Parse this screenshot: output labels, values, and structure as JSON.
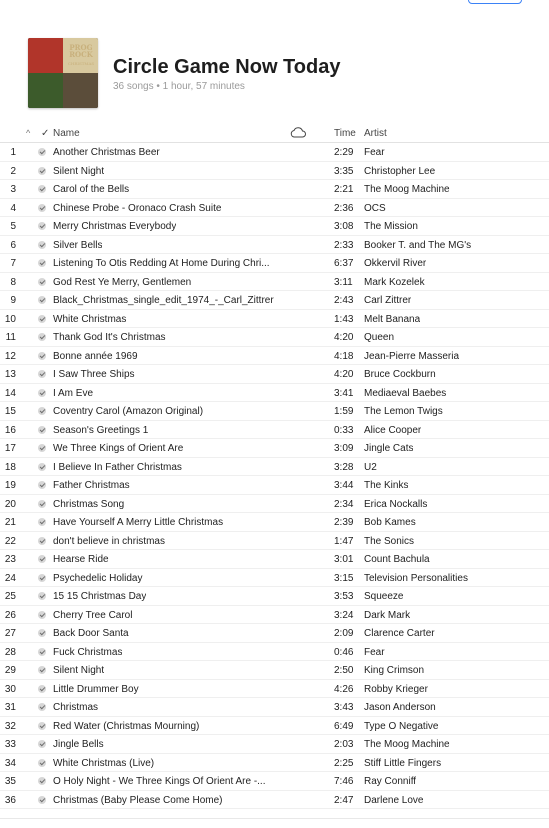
{
  "playlist": {
    "title": "Circle Game Now Today",
    "subtitle": "36 songs • 1 hour, 57 minutes",
    "art_text_main": "PROG ROCK",
    "art_text_sub": "CHRISTMAS"
  },
  "columns": {
    "sort_indicator": "^",
    "check": "✓",
    "name": "Name",
    "time": "Time",
    "artist": "Artist"
  },
  "icons": {
    "cloud": "cloud-icon",
    "check": "checkmark-icon"
  },
  "colors": {
    "accent": "#3b82f6"
  },
  "tracks": [
    {
      "num": "1",
      "name": "Another Christmas Beer",
      "time": "2:29",
      "artist": "Fear"
    },
    {
      "num": "2",
      "name": "Silent Night",
      "time": "3:35",
      "artist": "Christopher Lee"
    },
    {
      "num": "3",
      "name": "Carol of the Bells",
      "time": "2:21",
      "artist": "The Moog Machine"
    },
    {
      "num": "4",
      "name": "Chinese Probe - Oronaco Crash Suite",
      "time": "2:36",
      "artist": "OCS"
    },
    {
      "num": "5",
      "name": "Merry Christmas Everybody",
      "time": "3:08",
      "artist": "The Mission"
    },
    {
      "num": "6",
      "name": "Silver Bells",
      "time": "2:33",
      "artist": "Booker T. and The MG's"
    },
    {
      "num": "7",
      "name": "Listening To Otis Redding At Home During Chri...",
      "time": "6:37",
      "artist": "Okkervil River"
    },
    {
      "num": "8",
      "name": "God Rest Ye Merry, Gentlemen",
      "time": "3:11",
      "artist": "Mark Kozelek"
    },
    {
      "num": "9",
      "name": "Black_Christmas_single_edit_1974_-_Carl_Zittrer",
      "time": "2:43",
      "artist": "Carl Zittrer"
    },
    {
      "num": "10",
      "name": "White Christmas",
      "time": "1:43",
      "artist": "Melt Banana"
    },
    {
      "num": "11",
      "name": "Thank God It's Christmas",
      "time": "4:20",
      "artist": "Queen"
    },
    {
      "num": "12",
      "name": "Bonne année 1969",
      "time": "4:18",
      "artist": "Jean-Pierre Masseria"
    },
    {
      "num": "13",
      "name": "I Saw Three Ships",
      "time": "4:20",
      "artist": "Bruce Cockburn"
    },
    {
      "num": "14",
      "name": "I Am Eve",
      "time": "3:41",
      "artist": "Mediaeval Baebes"
    },
    {
      "num": "15",
      "name": "Coventry Carol  (Amazon Original)",
      "time": "1:59",
      "artist": "The Lemon Twigs"
    },
    {
      "num": "16",
      "name": "Season's Greetings 1",
      "time": "0:33",
      "artist": "Alice Cooper"
    },
    {
      "num": "17",
      "name": "We Three Kings of Orient Are",
      "time": "3:09",
      "artist": "Jingle Cats"
    },
    {
      "num": "18",
      "name": "I Believe In Father Christmas",
      "time": "3:28",
      "artist": "U2"
    },
    {
      "num": "19",
      "name": "Father Christmas",
      "time": "3:44",
      "artist": "The Kinks"
    },
    {
      "num": "20",
      "name": "Christmas Song",
      "time": "2:34",
      "artist": "Erica Nockalls"
    },
    {
      "num": "21",
      "name": "Have Yourself A Merry Little Christmas",
      "time": "2:39",
      "artist": "Bob Kames"
    },
    {
      "num": "22",
      "name": "don't believe in christmas",
      "time": "1:47",
      "artist": "The Sonics"
    },
    {
      "num": "23",
      "name": "Hearse Ride",
      "time": "3:01",
      "artist": "Count Bachula"
    },
    {
      "num": "24",
      "name": "Psychedelic Holiday",
      "time": "3:15",
      "artist": "Television Personalities"
    },
    {
      "num": "25",
      "name": "15 15 Christmas Day",
      "time": "3:53",
      "artist": "Squeeze"
    },
    {
      "num": "26",
      "name": "Cherry Tree Carol",
      "time": "3:24",
      "artist": "Dark Mark"
    },
    {
      "num": "27",
      "name": "Back Door Santa",
      "time": "2:09",
      "artist": "Clarence Carter"
    },
    {
      "num": "28",
      "name": "Fuck Christmas",
      "time": "0:46",
      "artist": "Fear"
    },
    {
      "num": "29",
      "name": "Silent Night",
      "time": "2:50",
      "artist": "King Crimson"
    },
    {
      "num": "30",
      "name": "Little Drummer Boy",
      "time": "4:26",
      "artist": "Robby Krieger"
    },
    {
      "num": "31",
      "name": "Christmas",
      "time": "3:43",
      "artist": "Jason Anderson"
    },
    {
      "num": "32",
      "name": "Red Water (Christmas Mourning)",
      "time": "6:49",
      "artist": "Type O Negative"
    },
    {
      "num": "33",
      "name": "Jingle Bells",
      "time": "2:03",
      "artist": "The Moog Machine"
    },
    {
      "num": "34",
      "name": "White Christmas (Live)",
      "time": "2:25",
      "artist": "Stiff Little Fingers"
    },
    {
      "num": "35",
      "name": "O Holy Night - We Three Kings Of Orient Are -...",
      "time": "7:46",
      "artist": "Ray Conniff"
    },
    {
      "num": "36",
      "name": "Christmas (Baby Please Come Home)",
      "time": "2:47",
      "artist": "Darlene Love"
    }
  ]
}
